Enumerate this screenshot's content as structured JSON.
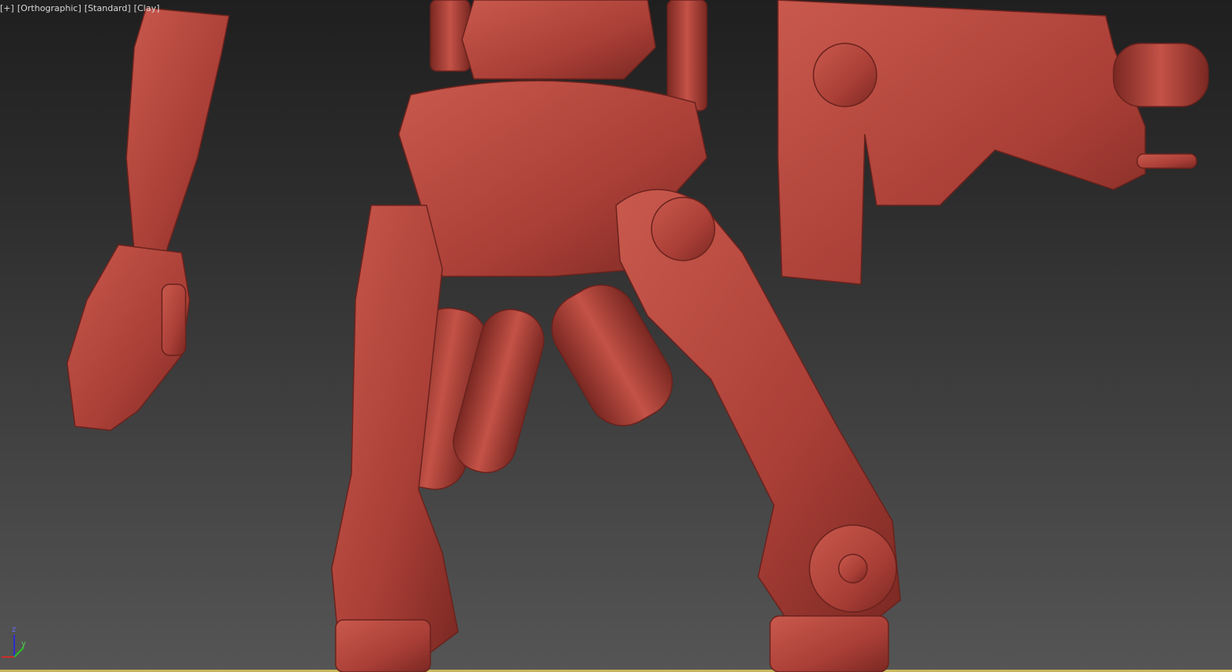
{
  "viewport": {
    "labels": [
      "[+]",
      "[Orthographic]",
      "[Standard]",
      "[Clay]"
    ],
    "axis_labels": {
      "z": "z",
      "y": "y"
    },
    "colors": {
      "clay": "#b0443b",
      "clay_shadow": "#7a2822",
      "clay_light": "#c9594d",
      "active_border": "#c9b45a"
    }
  }
}
